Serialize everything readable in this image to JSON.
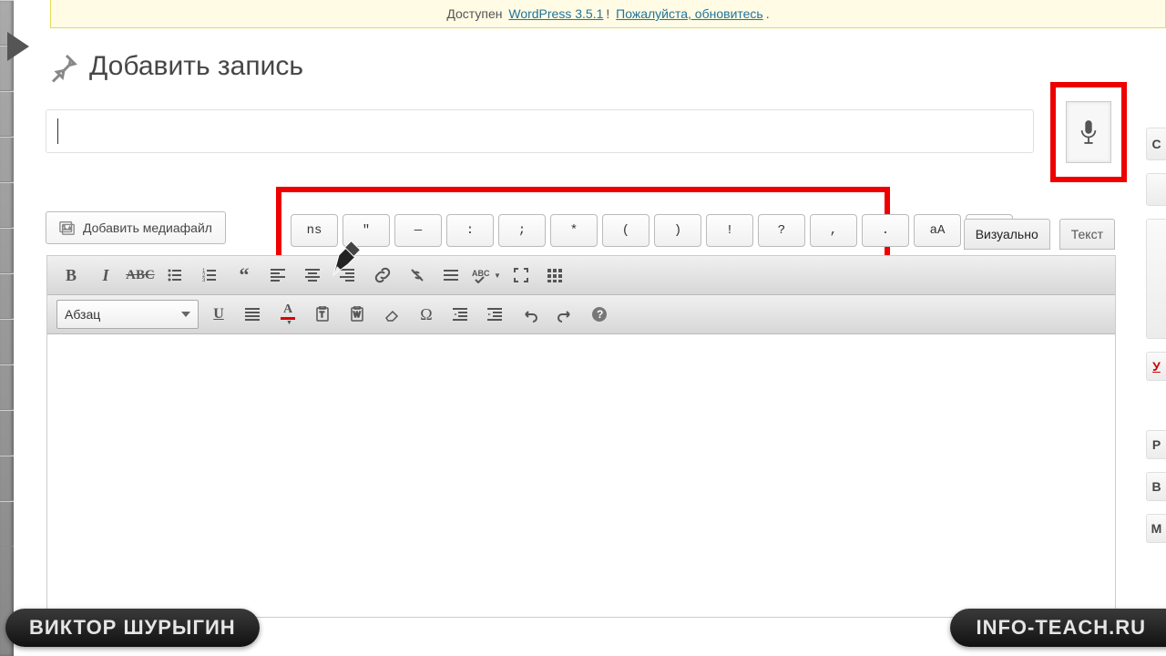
{
  "banner": {
    "prefix": "Доступен",
    "product": "WordPress 3.5.1",
    "sep": "!",
    "cta": "Пожалуйста, обновитесь",
    "end": "."
  },
  "page_title": "Добавить запись",
  "media_button": "Добавить медиафайл",
  "punct_buttons": [
    "ns",
    "\"",
    "—",
    ":",
    ";",
    "*",
    "(",
    ")",
    "!",
    "?",
    ",",
    ".",
    "аА",
    "⬇"
  ],
  "tabs": {
    "visual": "Визуально",
    "text": "Текст"
  },
  "format_select": "Абзац",
  "mic": {
    "icon": "microphone-icon"
  },
  "right_rail": [
    "С",
    "",
    "",
    "У",
    "Р",
    "В",
    "М"
  ],
  "footer": {
    "left": "ВИКТОР ШУРЫГИН",
    "right": "INFO-TEACH.RU"
  },
  "toolbar_row1": [
    "bold",
    "italic",
    "strike",
    "ul",
    "ol",
    "quote",
    "align-left",
    "align-center",
    "align-right",
    "link",
    "unlink",
    "more",
    "spell",
    "distraction",
    "kitchen"
  ],
  "toolbar_row2": [
    "format",
    "underline",
    "justify",
    "textcolor",
    "paste",
    "paste-word",
    "eraser",
    "omega",
    "outdent",
    "indent",
    "undo",
    "redo",
    "help"
  ]
}
